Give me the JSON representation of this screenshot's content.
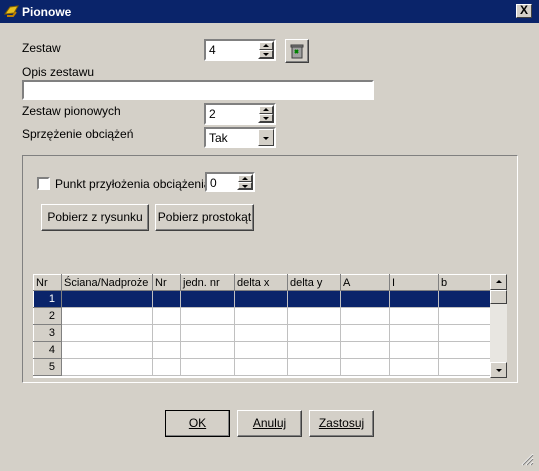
{
  "window": {
    "title": "Pionowe",
    "close_glyph": "X"
  },
  "form": {
    "zestaw_label": "Zestaw",
    "zestaw_value": "4",
    "opis_label": "Opis zestawu",
    "opis_value": "",
    "pionowych_label": "Zestaw pionowych",
    "pionowych_value": "2",
    "sprzezenie_label": "Sprzężenie obciążeń",
    "sprzezenie_value": "Tak"
  },
  "group": {
    "punkt_label": "Punkt przyłożenia obciążenia",
    "punkt_checked": false,
    "punkt_value": "0",
    "pobierz_rysunek": "Pobierz z rysunku",
    "pobierz_prostokat": "Pobierz prostokąt"
  },
  "table": {
    "columns": [
      "Nr",
      "Ściana/Nadproże",
      "Nr",
      "jedn. nr",
      "delta x",
      "delta y",
      "A",
      "I",
      "b"
    ],
    "rows": [
      "1",
      "2",
      "3",
      "4",
      "5"
    ],
    "selected_row": 0
  },
  "buttons": {
    "ok": "OK",
    "anuluj": "Anuluj",
    "zastosuj": "Zastosuj"
  },
  "colors": {
    "titlebar": "#0a246a",
    "face": "#d4d0c8",
    "selection": "#0a246a"
  }
}
